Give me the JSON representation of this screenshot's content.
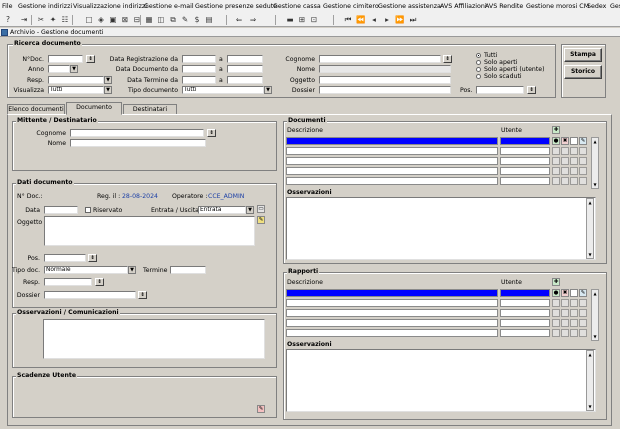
{
  "menu": [
    "File",
    "Gestione indirizzi",
    "Visualizzazione indirizzi",
    "Gestione e-mail",
    "Gestione presenze sedute",
    "Gestione cassa",
    "Gestione cimitero",
    "Gestione assistenza",
    "AVS Affiliazioni",
    "AVS Rendite",
    "Gestione morosi CM",
    "Sedex",
    "Ges"
  ],
  "window_title": "Archivio - Gestione documenti",
  "search": {
    "legend": "Ricerca documento",
    "ndoc": "N°Doc.",
    "anno": "Anno",
    "resp": "Resp.",
    "visualizza": "Visualizza",
    "visualizza_value": "Tutti",
    "data_reg": "Data Registrazione da",
    "data_doc": "Data Documento da",
    "data_term": "Data Termine da",
    "a": "a",
    "tipo_doc": "Tipo documento",
    "tipo_doc_value": "Tutti",
    "cognome": "Cognome",
    "nome": "Nome",
    "oggetto": "Oggetto",
    "dossier": "Dossier",
    "pos": "Pos.",
    "radio": [
      "Tutti",
      "Solo aperti",
      "Solo aperti (utente)",
      "Solo scaduti"
    ],
    "btn_print": "Stampa",
    "btn_history": "Storico"
  },
  "tabs": [
    "Elenco documenti",
    "Documento",
    "Destinatari"
  ],
  "mittente": {
    "legend": "Mittente / Destinatario",
    "cognome": "Cognome",
    "nome": "Nome"
  },
  "dati": {
    "legend": "Dati documento",
    "ndoc": "N° Doc.:",
    "reg": "Reg. il :",
    "reg_value": "28-08-2024",
    "operatore": "Operatore :",
    "operatore_value": "CCE_ADMIN",
    "data": "Data",
    "riservato": "Riservato",
    "entrata": "Entrata / Uscita",
    "entrata_value": "Entrata",
    "oggetto": "Oggetto",
    "pos": "Pos.",
    "tipo_doc": "Tipo doc.",
    "tipo_doc_value": "Normale",
    "termine": "Termine",
    "resp": "Resp.",
    "dossier": "Dossier"
  },
  "oss_com": {
    "legend": "Osservazioni / Comunicazioni"
  },
  "scadenze": {
    "legend": "Scadenze Utente"
  },
  "documenti": {
    "legend": "Documenti",
    "col_desc": "Descrizione",
    "col_user": "Utente",
    "oss": "Osservazioni"
  },
  "rapporti": {
    "legend": "Rapporti",
    "col_desc": "Descrizione",
    "col_user": "Utente",
    "oss": "Osservazioni"
  }
}
